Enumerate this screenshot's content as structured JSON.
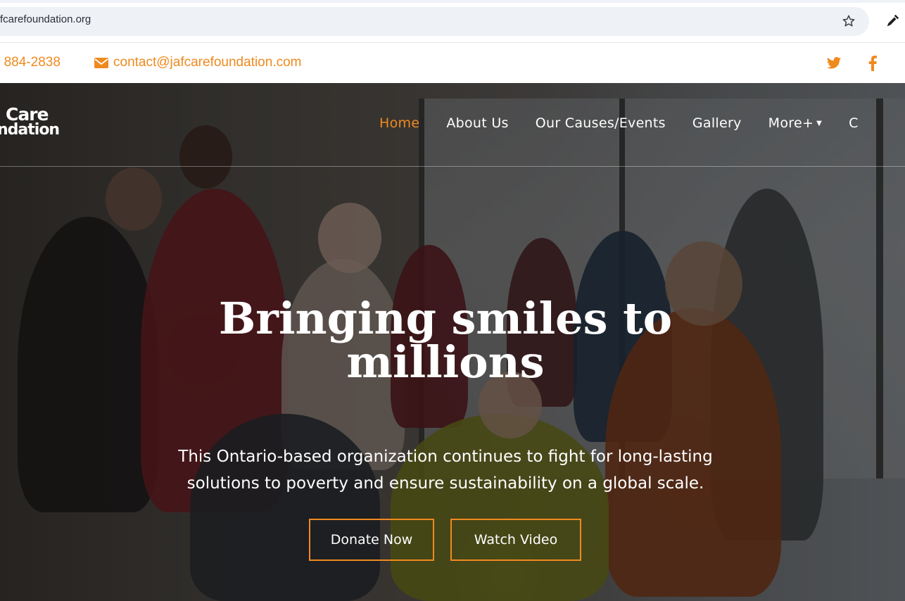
{
  "browser": {
    "url": "fcarefoundation.org"
  },
  "contact": {
    "phone": ") 884-2838",
    "email": "contact@jafcarefoundation.com"
  },
  "logo": {
    "line1": "Care",
    "line2": "ndation"
  },
  "nav": {
    "items": [
      {
        "label": "Home",
        "active": true
      },
      {
        "label": "About Us"
      },
      {
        "label": "Our Causes/Events"
      },
      {
        "label": "Gallery"
      },
      {
        "label": "More+"
      },
      {
        "label": "C"
      }
    ]
  },
  "hero": {
    "title_line1": "Bringing smiles to",
    "title_line2": "millions",
    "subtitle_line1": "This Ontario-based organization continues to fight for long-lasting",
    "subtitle_line2": "solutions to poverty and ensure sustainability on a global scale.",
    "donate_label": "Donate Now",
    "video_label": "Watch Video"
  },
  "colors": {
    "accent": "#ef8a1f",
    "hero_text": "#ffffff"
  },
  "icons": [
    "star-icon",
    "extension-icon",
    "mail-icon",
    "twitter-icon",
    "facebook-icon",
    "caret-down-icon"
  ]
}
